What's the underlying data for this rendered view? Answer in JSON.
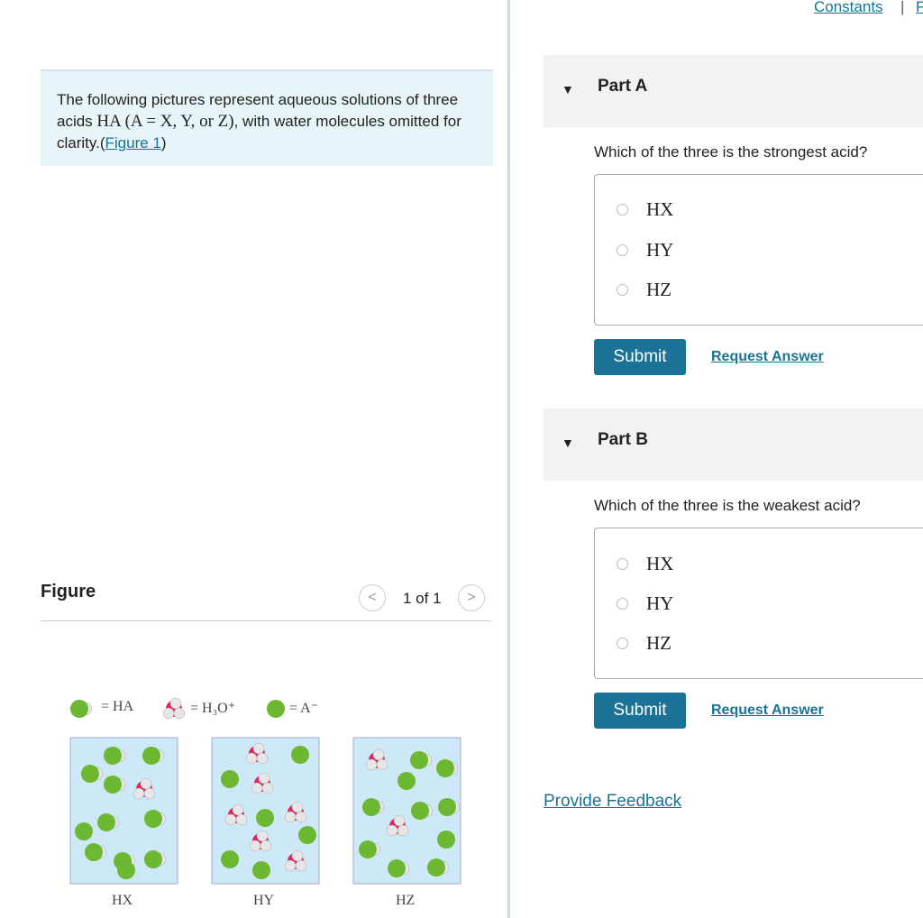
{
  "header": {
    "constants_link": "Constants",
    "separator": "|",
    "next_link_partial": "P"
  },
  "intro": {
    "text1": "The following pictures represent aqueous solutions of three acids ",
    "formula": "HA (A = X, Y, or Z)",
    "text2": ", with water molecules omitted for clarity.(",
    "figure_link": "Figure 1",
    "text3": ")"
  },
  "figure": {
    "title": "Figure",
    "pager": "1 of 1",
    "prev": "<",
    "next": ">",
    "legend": {
      "ha": "= HA",
      "h3o": "= H₃O⁺",
      "a": "= A⁻"
    },
    "boxes": [
      "HX",
      "HY",
      "HZ"
    ],
    "colors": {
      "water": "#cde8f7",
      "green": "#6cb832",
      "white": "#e6e6e6",
      "red": "#e0245e"
    }
  },
  "parts": [
    {
      "label": "Part A",
      "question": "Which of the three is the strongest acid?",
      "options": [
        "HX",
        "HY",
        "HZ"
      ],
      "submit": "Submit",
      "request": "Request Answer"
    },
    {
      "label": "Part B",
      "question": "Which of the three is the weakest acid?",
      "options": [
        "HX",
        "HY",
        "HZ"
      ],
      "submit": "Submit",
      "request": "Request Answer"
    }
  ],
  "feedback": "Provide Feedback"
}
